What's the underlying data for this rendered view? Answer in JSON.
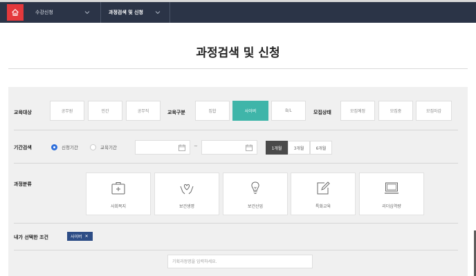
{
  "nav": {
    "menu1": "수강신청",
    "menu2": "과정검색 및 신청"
  },
  "page": {
    "title": "과정검색 및 신청"
  },
  "filters": {
    "target": {
      "label": "교육대상",
      "options": [
        "공무원",
        "민간",
        "공무직"
      ]
    },
    "edu_type": {
      "label": "교육구분",
      "options": [
        "집합",
        "사이버",
        "B/L"
      ],
      "selected": "사이버"
    },
    "status": {
      "label": "모집상태",
      "options": [
        "모집예정",
        "모집중",
        "모집마감"
      ]
    },
    "period": {
      "label": "기간검색",
      "radio_apply": "신청기간",
      "radio_edu": "교육기간",
      "separator": "~",
      "buttons": [
        "1개월",
        "3개월",
        "6개월"
      ],
      "selected": "1개월"
    },
    "category": {
      "label": "과정분류",
      "items": [
        {
          "label": "사회복지",
          "icon": "medical-kit-icon"
        },
        {
          "label": "보건생명",
          "icon": "heart-hands-icon"
        },
        {
          "label": "보건산업",
          "icon": "lightbulb-icon"
        },
        {
          "label": "특화교육",
          "icon": "edit-icon"
        },
        {
          "label": "리더십역량",
          "icon": "monitor-icon"
        }
      ]
    },
    "selected_conditions": {
      "label": "내가 선택한 조건",
      "tags": [
        "사이버"
      ]
    },
    "search": {
      "placeholder": "기획과정명을 입력하세요."
    }
  },
  "colors": {
    "nav_bg": "#2b3447",
    "home_bg": "#e4393c",
    "accent": "#3fb5a9",
    "tag_bg": "#2d4d86",
    "radio": "#2e6fdc",
    "period_active": "#4a4a4a"
  }
}
